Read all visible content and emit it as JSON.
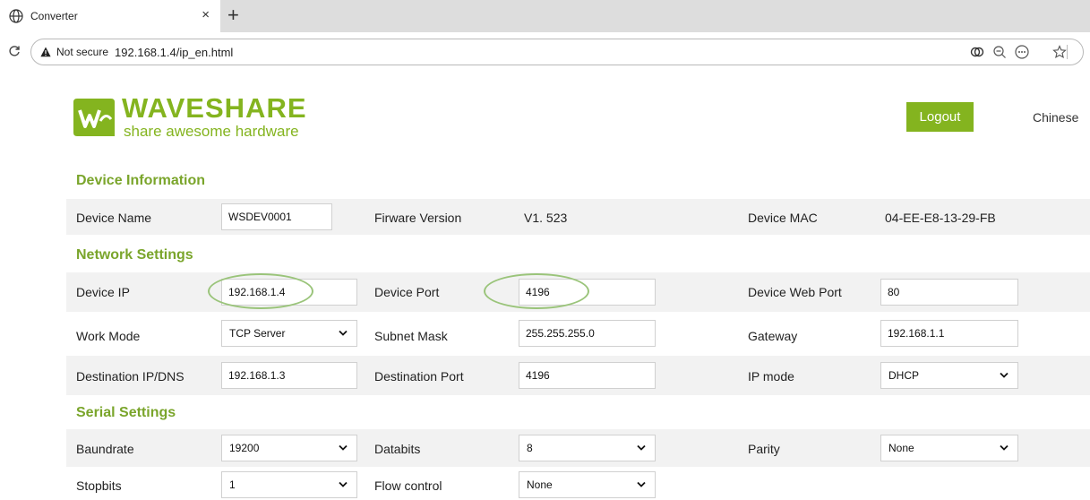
{
  "browser": {
    "tab_title": "Converter",
    "tab_close": "×",
    "new_tab": "+",
    "security_label": "Not secure",
    "url": "192.168.1.4/ip_en.html"
  },
  "header": {
    "logo_brand": "WAVESHARE",
    "logo_tagline": "share awesome hardware",
    "logout_label": "Logout",
    "language_label": "Chinese"
  },
  "device_info": {
    "title": "Device Information",
    "device_name_label": "Device Name",
    "device_name_value": "WSDEV0001",
    "firmware_label": "Firware Version",
    "firmware_value": "V1. 523",
    "mac_label": "Device MAC",
    "mac_value": "04-EE-E8-13-29-FB"
  },
  "network": {
    "title": "Network Settings",
    "device_ip_label": "Device IP",
    "device_ip_value": "192.168.1.4",
    "device_port_label": "Device Port",
    "device_port_value": "4196",
    "web_port_label": "Device Web Port",
    "web_port_value": "80",
    "work_mode_label": "Work Mode",
    "work_mode_value": "TCP Server",
    "subnet_label": "Subnet Mask",
    "subnet_value": "255.255.255.0",
    "gateway_label": "Gateway",
    "gateway_value": "192.168.1.1",
    "dest_ip_label": "Destination IP/DNS",
    "dest_ip_value": "192.168.1.3",
    "dest_port_label": "Destination Port",
    "dest_port_value": "4196",
    "ip_mode_label": "IP mode",
    "ip_mode_value": "DHCP"
  },
  "serial": {
    "title": "Serial Settings",
    "baud_label": "Baundrate",
    "baud_value": "19200",
    "databits_label": "Databits",
    "databits_value": "8",
    "parity_label": "Parity",
    "parity_value": "None",
    "stopbits_label": "Stopbits",
    "stopbits_value": "1",
    "flow_label": "Flow control",
    "flow_value": "None"
  },
  "colors": {
    "accent": "#84b41f",
    "section_title": "#7aa52b",
    "row_background": "#f2f2f2",
    "highlight_ring": "#9ac47a"
  }
}
